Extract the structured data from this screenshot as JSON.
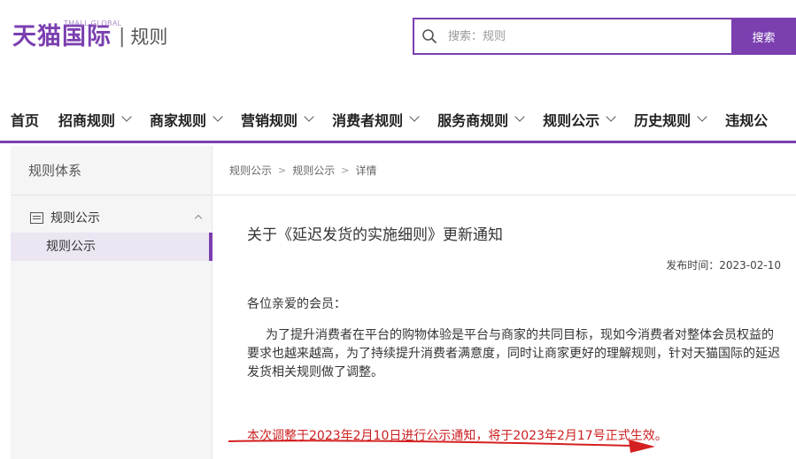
{
  "header": {
    "logo_main": "天猫国际",
    "logo_global": "TMALL GLOBAL",
    "logo_divider": "|",
    "logo_sub": "规则",
    "search_placeholder": "搜索：规则",
    "search_button": "搜索"
  },
  "nav": {
    "items": [
      {
        "label": "首页",
        "has_dropdown": false
      },
      {
        "label": "招商规则",
        "has_dropdown": true
      },
      {
        "label": "商家规则",
        "has_dropdown": true
      },
      {
        "label": "营销规则",
        "has_dropdown": true
      },
      {
        "label": "消费者规则",
        "has_dropdown": true
      },
      {
        "label": "服务商规则",
        "has_dropdown": true
      },
      {
        "label": "规则公示",
        "has_dropdown": true
      },
      {
        "label": "历史规则",
        "has_dropdown": true
      },
      {
        "label": "违规公",
        "has_dropdown": false
      }
    ]
  },
  "sidebar": {
    "title": "规则体系",
    "group_label": "规则公示",
    "active_item": "规则公示"
  },
  "breadcrumb": [
    "规则公示",
    "规则公示",
    "详情"
  ],
  "article": {
    "title": "关于《延迟发货的实施细则》更新通知",
    "publish_time": "发布时间：2023-02-10",
    "greeting": "各位亲爱的会员：",
    "paragraph": "为了提升消费者在平台的购物体验是平台与商家的共同目标，现如今消费者对整体会员权益的要求也越来越高，为了持续提升消费者满意度，同时让商家更好的理解规则，针对天猫国际的延迟发货相关规则做了调整。",
    "notice": "本次调整于2023年2月10日进行公示通知，将于2023年2月17号正式生效。"
  },
  "colors": {
    "brand_purple": "#7b3fb0",
    "notice_red": "#cc1f1f",
    "annotation_arrow": "#d42020"
  }
}
